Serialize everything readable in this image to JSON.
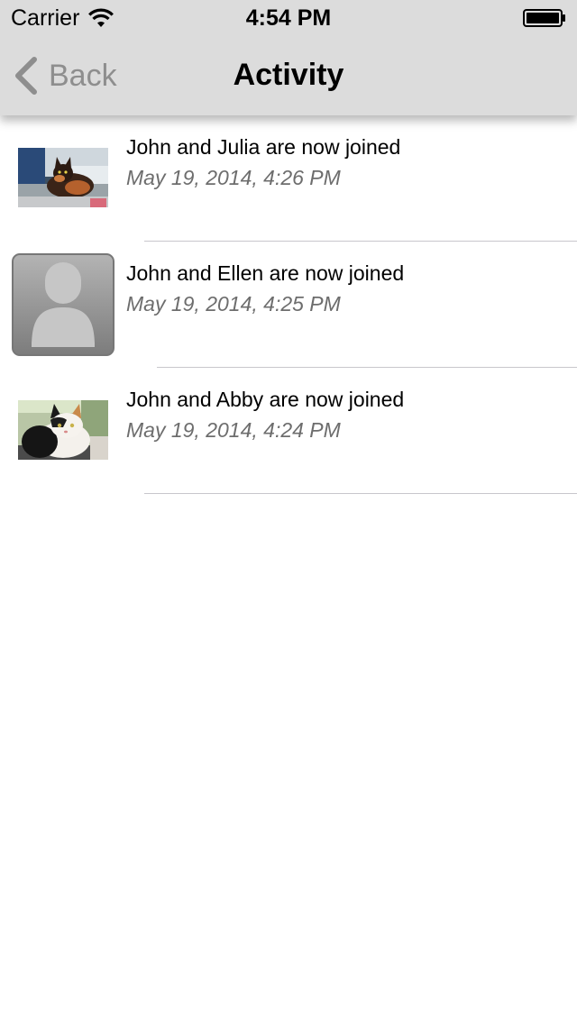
{
  "status_bar": {
    "carrier": "Carrier",
    "time": "4:54 PM",
    "wifi_icon": "wifi-icon",
    "battery_icon": "battery-icon"
  },
  "nav": {
    "back_label": "Back",
    "back_icon": "chevron-left-icon",
    "title": "Activity"
  },
  "activity": [
    {
      "title": "John and Julia are now joined",
      "date": "May 19, 2014, 4:26 PM",
      "avatar": "photo-cat-tortoiseshell"
    },
    {
      "title": "John and Ellen are now joined",
      "date": "May 19, 2014, 4:25 PM",
      "avatar": "placeholder-person-icon"
    },
    {
      "title": "John and Abby are now joined",
      "date": "May 19, 2014, 4:24 PM",
      "avatar": "photo-cat-calico"
    }
  ],
  "colors": {
    "header_bg": "#dcdcdc",
    "back_tint": "#8e8e8e",
    "date_text": "#6d6d6d",
    "separator": "#c8c7cc"
  }
}
